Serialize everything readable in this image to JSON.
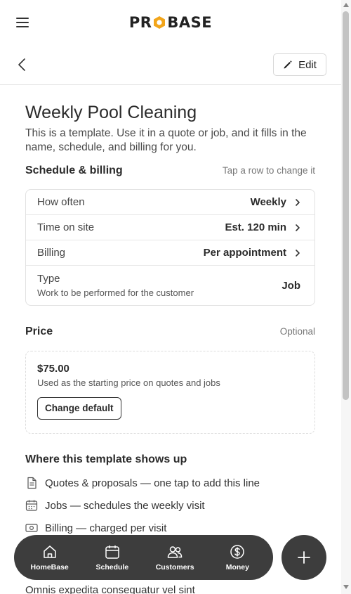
{
  "header": {
    "logo_left": "PR",
    "logo_right": "BASE",
    "edit_label": "Edit"
  },
  "page": {
    "title": "Weekly Pool Cleaning",
    "description": "This is a template. Use it in a quote or job, and it fills in the name, schedule, and billing for you."
  },
  "schedule": {
    "title": "Schedule & billing",
    "hint": "Tap a row to change it",
    "rows": [
      {
        "label": "How often",
        "value": "Weekly"
      },
      {
        "label": "Time on site",
        "value": "Est. 120 min"
      },
      {
        "label": "Billing",
        "value": "Per appointment"
      },
      {
        "label": "Type",
        "sub": "Work to be performed for the customer",
        "value": "Job"
      }
    ]
  },
  "price": {
    "title": "Price",
    "hint": "Optional",
    "amount": "$75.00",
    "description": "Used as the starting price on quotes and jobs",
    "change_label": "Change default"
  },
  "usage": {
    "title": "Where this template shows up",
    "items": [
      {
        "text": "Quotes & proposals — one tap to add this line",
        "icon": "document-icon"
      },
      {
        "text": "Jobs — schedules the weekly visit",
        "icon": "calendar-icon"
      },
      {
        "text": "Billing — charged per visit",
        "icon": "cash-icon"
      }
    ],
    "partial_text": "Omnis expedita consequatur vel sint"
  },
  "nav": {
    "items": [
      {
        "label": "HomeBase",
        "icon": "home-icon"
      },
      {
        "label": "Schedule",
        "icon": "calendar-icon"
      },
      {
        "label": "Customers",
        "icon": "users-icon"
      },
      {
        "label": "Money",
        "icon": "dollar-icon"
      }
    ],
    "fab_icon": "plus-icon"
  },
  "colors": {
    "nav_bg": "#3d3d3d",
    "logo_accent": "#f2a51a",
    "text": "#2b2b2b"
  }
}
